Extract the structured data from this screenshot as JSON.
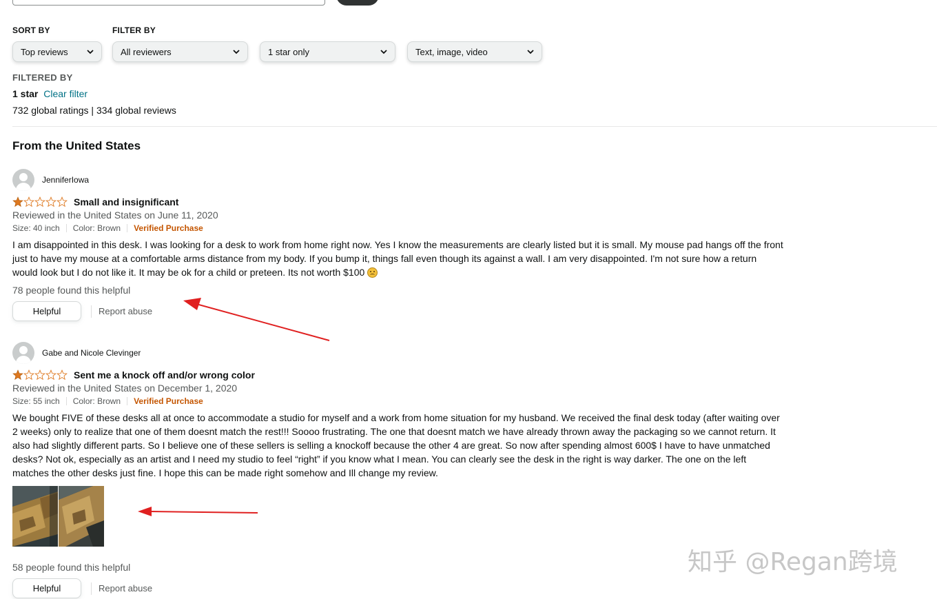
{
  "sort": {
    "label": "SORT BY",
    "value": "Top reviews"
  },
  "filter": {
    "label": "FILTER BY",
    "reviewers": "All reviewers",
    "stars": "1 star only",
    "media": "Text, image, video"
  },
  "filtered_by": {
    "label": "FILTERED BY",
    "value": "1 star",
    "clear": "Clear filter",
    "counts": "732 global ratings | 334 global reviews"
  },
  "section_title": "From the United States",
  "reviews": [
    {
      "author": "JenniferIowa",
      "rating": 1,
      "title": "Small and insignificant",
      "date": "Reviewed in the United States on June 11, 2020",
      "size": "Size: 40 inch",
      "color": "Color: Brown",
      "verified": "Verified Purchase",
      "body": "I am disappointed in this desk. I was looking for a desk to work from home right now. Yes I know the measurements are clearly listed but it is small. My mouse pad hangs off the front just to have my mouse at a comfortable arms distance from my body. If you bump it, things fall even though its against a wall. I am very disappointed. I'm not sure how a return would look but I do not like it. It may be ok for a child or preteen. Its not worth $100",
      "helpful_count": "78 people found this helpful",
      "helpful_label": "Helpful",
      "report_label": "Report abuse"
    },
    {
      "author": "Gabe and Nicole Clevinger",
      "rating": 1,
      "title": "Sent me a knock off and/or wrong color",
      "date": "Reviewed in the United States on December 1, 2020",
      "size": "Size: 55 inch",
      "color": "Color: Brown",
      "verified": "Verified Purchase",
      "body": "We bought FIVE of these desks all at once to accommodate a studio for myself and a work from home situation for my husband. We received the final desk today (after waiting over 2 weeks) only to realize that one of them doesnt match the rest!!! Soooo frustrating. The one that doesnt match we have already thrown away the packaging so we cannot return. It also had slightly different parts. So I believe one of these sellers is selling a knockoff because the other 4 are great. So now after spending almost 600$ I have to have unmatched desks? Not ok, especially as an artist and I need my studio to feel “right” if you know what I mean. You can clearly see the desk in the right is way darker. The one on the left matches the other desks just fine. I hope this can be made right somehow and Ill change my review.",
      "helpful_count": "58 people found this helpful",
      "helpful_label": "Helpful",
      "report_label": "Report abuse"
    }
  ],
  "watermark": "知乎 @Regan跨境",
  "colors": {
    "star_fill": "#de7921",
    "link": "#007185",
    "verified": "#c45500",
    "arrow": "#e02020"
  }
}
